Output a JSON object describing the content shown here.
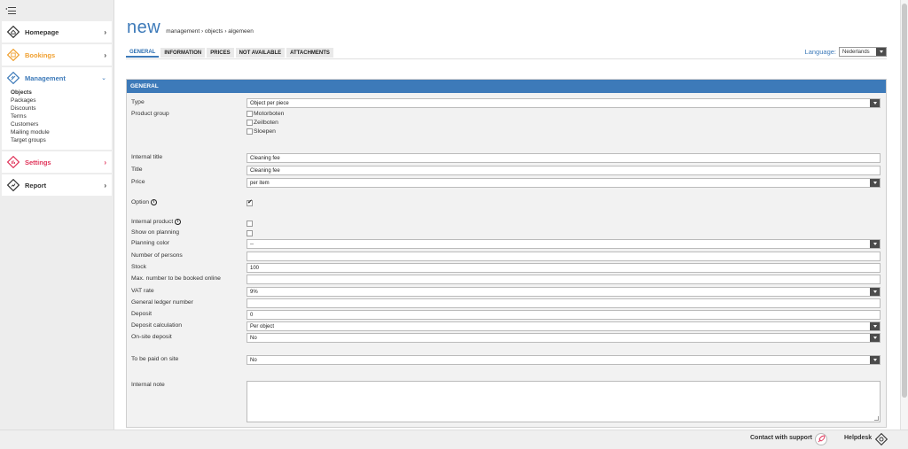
{
  "sidebar": {
    "items": [
      {
        "label": "Homepage",
        "icon": "home-icon",
        "color": "#333333"
      },
      {
        "label": "Bookings",
        "icon": "bookings-icon",
        "color": "#f0a030"
      },
      {
        "label": "Management",
        "icon": "management-icon",
        "color": "#3d7ab9"
      },
      {
        "label": "Settings",
        "icon": "settings-icon",
        "color": "#e0345a"
      },
      {
        "label": "Report",
        "icon": "report-icon",
        "color": "#333333"
      }
    ],
    "management_subitems": [
      "Objects",
      "Packages",
      "Discounts",
      "Terms",
      "Customers",
      "Mailing module",
      "Target groups"
    ]
  },
  "header": {
    "title": "new",
    "breadcrumb": "management › objects › algemeen"
  },
  "tabs": [
    "GENERAL",
    "INFORMATION",
    "PRICES",
    "NOT AVAILABLE",
    "ATTACHMENTS"
  ],
  "language": {
    "label": "Language:",
    "value": "Nederlands"
  },
  "panel": {
    "title": "GENERAL"
  },
  "form": {
    "type": {
      "label": "Type",
      "value": "Object per piece"
    },
    "product_group": {
      "label": "Product group",
      "options": [
        "Motorboten",
        "Zeilboten",
        "Sloepen"
      ]
    },
    "internal_title": {
      "label": "Internal title",
      "value": "Cleaning fee"
    },
    "title": {
      "label": "Title",
      "value": "Cleaning fee"
    },
    "price": {
      "label": "Price",
      "value": "per item"
    },
    "option": {
      "label": "Option",
      "checked": true
    },
    "internal_product": {
      "label": "Internal product"
    },
    "show_on_planning": {
      "label": "Show on planning"
    },
    "planning_color": {
      "label": "Planning color",
      "value": "--"
    },
    "number_of_persons": {
      "label": "Number of persons",
      "value": ""
    },
    "stock": {
      "label": "Stock",
      "value": "100"
    },
    "max_booked_online": {
      "label": "Max. number to be booked online",
      "value": ""
    },
    "vat_rate": {
      "label": "VAT rate",
      "value": "9%"
    },
    "ledger_number": {
      "label": "General ledger number",
      "value": ""
    },
    "deposit": {
      "label": "Deposit",
      "value": "0"
    },
    "deposit_calc": {
      "label": "Deposit calculation",
      "value": "Per object"
    },
    "onsite_deposit": {
      "label": "On-site deposit",
      "value": "No"
    },
    "paid_on_site": {
      "label": "To be paid on site",
      "value": "No"
    },
    "internal_note": {
      "label": "Internal note",
      "value": ""
    }
  },
  "footer": {
    "support": "Contact with support",
    "helpdesk": "Helpdesk"
  },
  "colors": {
    "accent": "#3d7ab9",
    "dark_button": "#4c4c4c"
  }
}
